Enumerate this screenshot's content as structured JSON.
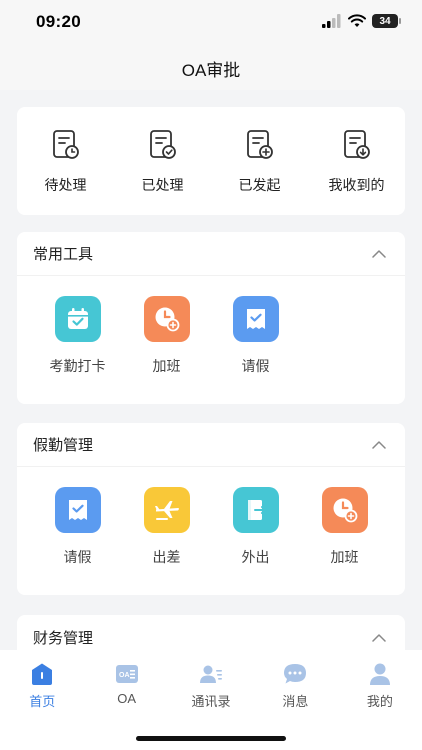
{
  "status": {
    "time": "09:20",
    "battery": "34"
  },
  "nav": {
    "title": "OA审批"
  },
  "quick_actions": [
    {
      "label": "待处理",
      "icon": "doc-clock-icon"
    },
    {
      "label": "已处理",
      "icon": "doc-check-icon"
    },
    {
      "label": "已发起",
      "icon": "doc-plus-icon"
    },
    {
      "label": "我收到的",
      "icon": "doc-download-icon"
    }
  ],
  "common_tools": {
    "title": "常用工具",
    "items": [
      {
        "label": "考勤打卡",
        "icon": "calendar-check-icon",
        "color": "#46c6d4"
      },
      {
        "label": "加班",
        "icon": "clock-plus-icon",
        "color": "#f58a58"
      },
      {
        "label": "请假",
        "icon": "note-check-icon",
        "color": "#5b9bf0"
      }
    ]
  },
  "leave_management": {
    "title": "假勤管理",
    "items": [
      {
        "label": "请假",
        "icon": "note-check-icon",
        "color": "#5b9bf0"
      },
      {
        "label": "出差",
        "icon": "airplane-icon",
        "color": "#f9c838"
      },
      {
        "label": "外出",
        "icon": "exit-door-icon",
        "color": "#46c6d4"
      },
      {
        "label": "加班",
        "icon": "clock-plus-icon",
        "color": "#f58a58"
      }
    ]
  },
  "finance_management": {
    "title": "财务管理"
  },
  "tab_bar": {
    "active_color": "#3b7fe2",
    "tabs": [
      {
        "label": "首页",
        "icon": "home-icon",
        "active": true
      },
      {
        "label": "OA",
        "icon": "oa-card-icon"
      },
      {
        "label": "通讯录",
        "icon": "contacts-icon"
      },
      {
        "label": "消息",
        "icon": "message-icon"
      },
      {
        "label": "我的",
        "icon": "profile-icon"
      }
    ]
  }
}
